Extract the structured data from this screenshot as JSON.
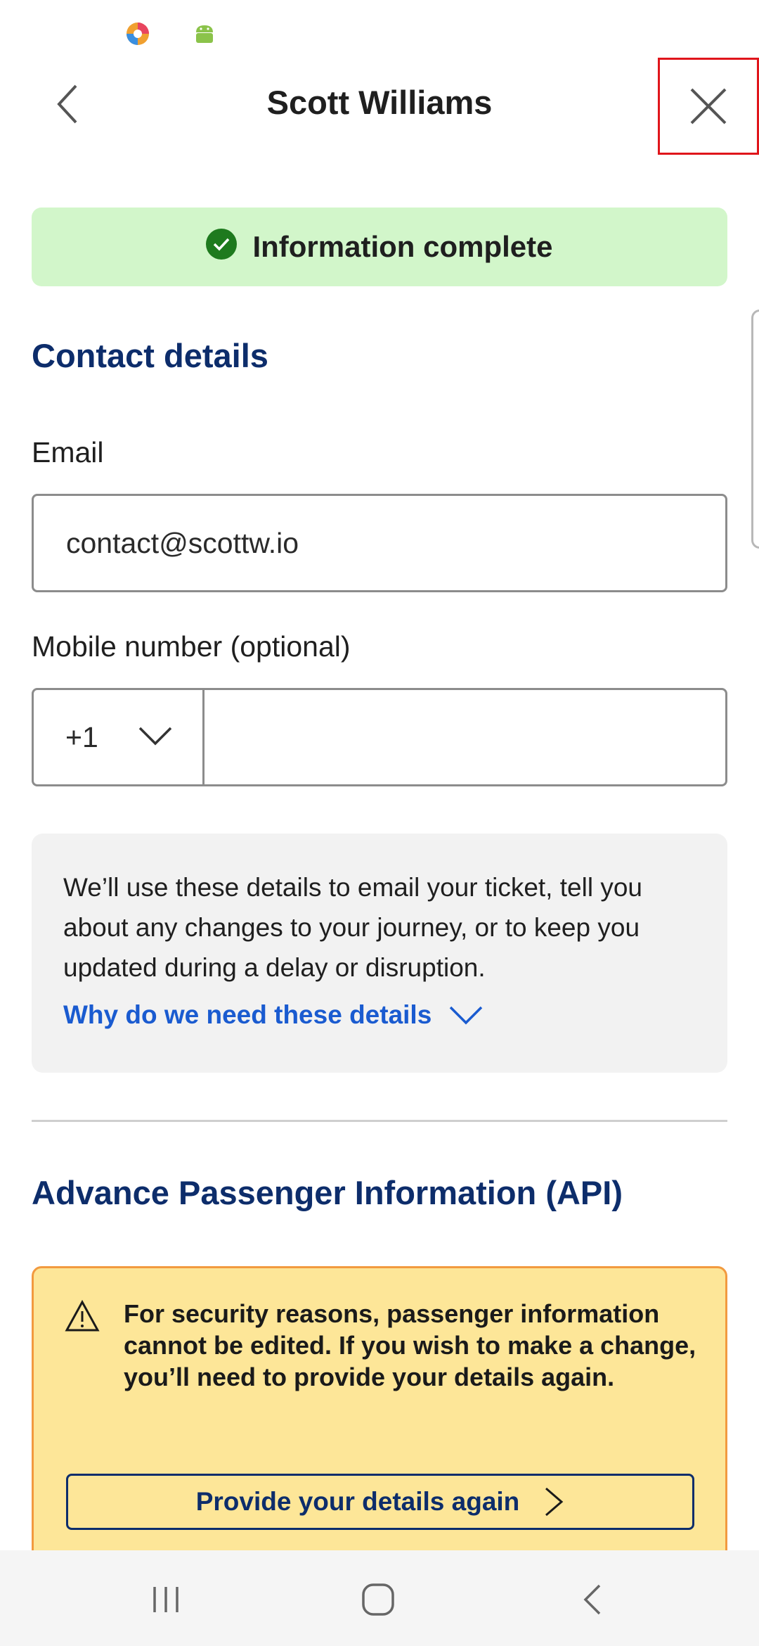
{
  "header": {
    "title": "Scott Williams"
  },
  "status_banner": {
    "text": "Information complete",
    "color": "#d2f6ca",
    "icon": "check-circle-icon"
  },
  "contact_section": {
    "title": "Contact details",
    "email": {
      "label": "Email",
      "value": "contact@scottw.io"
    },
    "mobile": {
      "label": "Mobile number (optional)",
      "country_code": "+1",
      "value": ""
    },
    "info": {
      "text": "We’ll use these details to email your ticket, tell you about any changes to your journey, or to keep you updated during a delay or disruption.",
      "link": "Why do we need these details"
    }
  },
  "api_section": {
    "title": "Advance Passenger Information (API)",
    "warning": {
      "text": "For security reasons, passenger information cannot be edited. If you wish to make a change, you’ll need to provide your details again.",
      "button": "Provide your details again",
      "background": "#fde698",
      "border": "#f29a3f"
    }
  },
  "colors": {
    "heading": "#0d2d6b",
    "link": "#1a5bd0",
    "highlight_box": "#e0151b"
  }
}
